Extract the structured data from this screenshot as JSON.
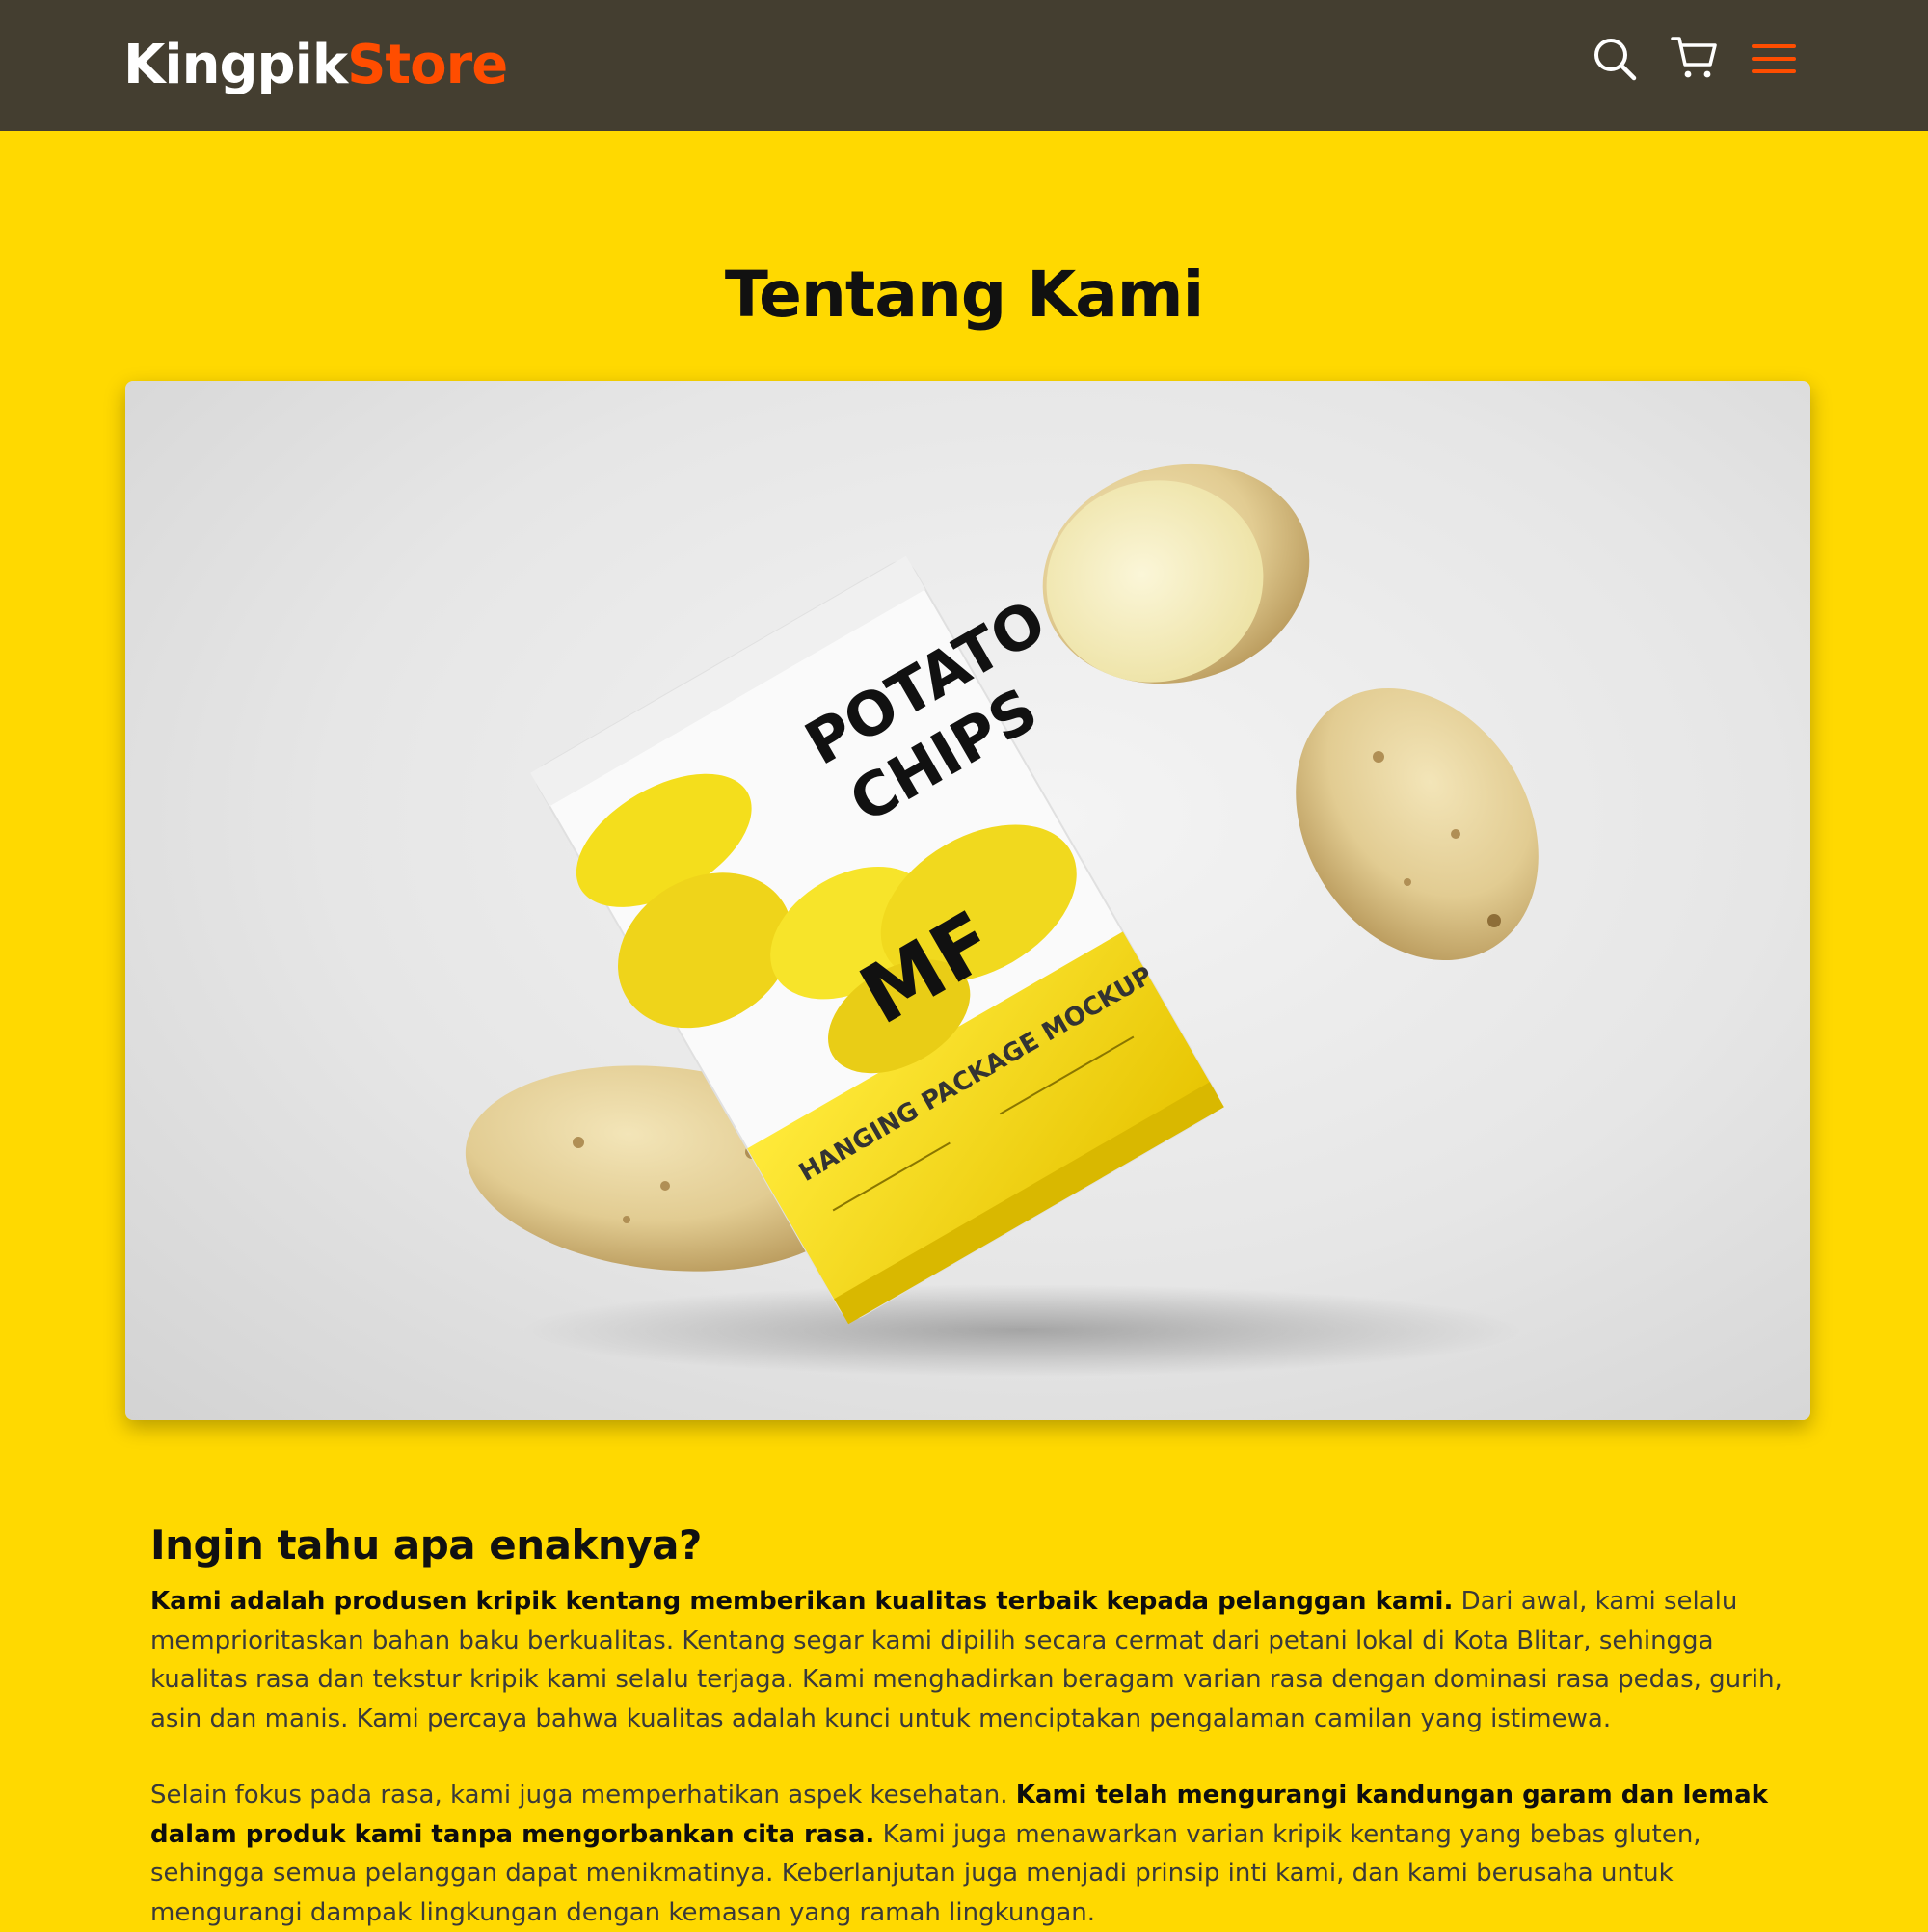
{
  "brand": {
    "part1": "Kingpik",
    "part2": "Store",
    "color_part1": "#FFFFFF",
    "color_part2": "#FF4D00"
  },
  "nav": {
    "icons": [
      "search-icon",
      "cart-icon",
      "menu-icon"
    ],
    "background": "#443E30"
  },
  "page": {
    "title": "Tentang Kami",
    "background": "#FFD900"
  },
  "hero": {
    "package_text_line1": "POTATO",
    "package_text_line2": "CHIPS",
    "package_logo": "MF",
    "package_band_text": "HANGING PACKAGE MOCKUP"
  },
  "about": {
    "heading": "Ingin tahu apa enaknya?",
    "p1_bold": "Kami adalah produsen kripik kentang memberikan kualitas terbaik kepada pelanggan kami.",
    "p1_rest": " Dari awal, kami selalu memprioritaskan bahan baku berkualitas. Kentang segar kami dipilih secara cermat dari petani lokal di Kota Blitar, sehingga kualitas rasa dan tekstur kripik kami selalu terjaga. Kami menghadirkan beragam varian rasa dengan dominasi rasa pedas, gurih, asin dan manis. Kami percaya bahwa kualitas adalah kunci untuk menciptakan pengalaman camilan yang istimewa.",
    "p2_start": "Selain fokus pada rasa, kami juga memperhatikan aspek kesehatan. ",
    "p2_bold": "Kami telah mengurangi kandungan garam dan lemak dalam produk kami tanpa mengorbankan cita rasa.",
    "p2_rest": " Kami juga menawarkan varian kripik kentang yang bebas gluten, sehingga semua pelanggan dapat menikmatinya. Keberlanjutan juga menjadi prinsip inti kami, dan kami berusaha untuk mengurangi dampak lingkungan dengan kemasan yang ramah lingkungan."
  }
}
